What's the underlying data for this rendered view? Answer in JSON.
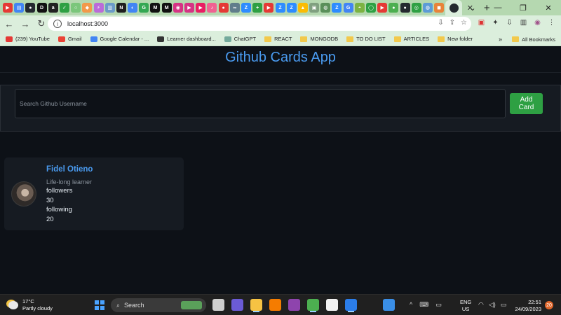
{
  "browser": {
    "tabs": [
      {
        "icon": "youtube-icon",
        "color": "#e53935",
        "glyph": "▶"
      },
      {
        "icon": "docs-icon",
        "color": "#4285f4",
        "glyph": "▤"
      },
      {
        "icon": "github-icon",
        "color": "#24292f",
        "glyph": "●"
      },
      {
        "icon": "dev-icon",
        "color": "#111111",
        "glyph": "D"
      },
      {
        "icon": "amazon-icon",
        "color": "#222222",
        "glyph": "a"
      },
      {
        "icon": "codepen-icon",
        "color": "#2ea043",
        "glyph": "✓"
      },
      {
        "icon": "gh-pages-icon",
        "color": "#7bc67b",
        "glyph": "○"
      },
      {
        "icon": "craft-icon",
        "color": "#f2994a",
        "glyph": "◆"
      },
      {
        "icon": "vitejs-icon",
        "color": "#bb6bd9",
        "glyph": "⚡"
      },
      {
        "icon": "database-icon",
        "color": "#6b9bc8",
        "glyph": "▥"
      },
      {
        "icon": "notion-icon",
        "color": "#1f1f1f",
        "glyph": "N"
      },
      {
        "icon": "chrome-app-icon",
        "color": "#4285f4",
        "glyph": "◐"
      },
      {
        "icon": "google-icon",
        "color": "#34a853",
        "glyph": "G"
      },
      {
        "icon": "medium-icon",
        "color": "#111111",
        "glyph": "M"
      },
      {
        "icon": "medium-alt-icon",
        "color": "#111111",
        "glyph": "M"
      },
      {
        "icon": "podcast-icon",
        "color": "#d63384",
        "glyph": "◉"
      },
      {
        "icon": "video-icon",
        "color": "#d63384",
        "glyph": "▶"
      },
      {
        "icon": "play-icon",
        "color": "#e91e63",
        "glyph": "▶"
      },
      {
        "icon": "music-icon",
        "color": "#f06292",
        "glyph": "♪"
      },
      {
        "icon": "record-icon",
        "color": "#e53935",
        "glyph": "●"
      },
      {
        "icon": "link-icon",
        "color": "#607d8b",
        "glyph": "∞"
      },
      {
        "icon": "zoom-icon",
        "color": "#2d8cff",
        "glyph": "Z"
      },
      {
        "icon": "plus-app-icon",
        "color": "#2ea043",
        "glyph": "+"
      },
      {
        "icon": "youtube-alt-icon",
        "color": "#e53935",
        "glyph": "▶"
      },
      {
        "icon": "zoom-alt-icon",
        "color": "#2d8cff",
        "glyph": "Z"
      },
      {
        "icon": "zoom-meet-icon",
        "color": "#2d8cff",
        "glyph": "Z"
      },
      {
        "icon": "drive-icon",
        "color": "#fbbc04",
        "glyph": "▲"
      },
      {
        "icon": "images-icon",
        "color": "#80a080",
        "glyph": "▣"
      },
      {
        "icon": "globe-icon",
        "color": "#5a8f5a",
        "glyph": "◍"
      },
      {
        "icon": "zoom-web-icon",
        "color": "#2d8cff",
        "glyph": "Z"
      },
      {
        "icon": "google-alt-icon",
        "color": "#4285f4",
        "glyph": "G"
      },
      {
        "icon": "gradient-icon",
        "color": "#7cb342",
        "glyph": "◓"
      },
      {
        "icon": "whatsapp-icon",
        "color": "#2ea043",
        "glyph": "◯"
      },
      {
        "icon": "youtube-third-icon",
        "color": "#e53935",
        "glyph": "▶"
      },
      {
        "icon": "circle-green-icon",
        "color": "#4caf50",
        "glyph": "●"
      },
      {
        "icon": "github-alt-icon",
        "color": "#24292f",
        "glyph": "●"
      },
      {
        "icon": "compass-icon",
        "color": "#2ea043",
        "glyph": "◎"
      },
      {
        "icon": "world-icon",
        "color": "#5c9bd6",
        "glyph": "◍"
      },
      {
        "icon": "bookmark-tab-icon",
        "color": "#e8833a",
        "glyph": "◼"
      }
    ],
    "close_glyph": "✕",
    "new_tab_glyph": "+",
    "window_controls": {
      "dropdown": "⌄",
      "minimize": "—",
      "restore": "❐",
      "close": "✕"
    },
    "nav": {
      "back": "←",
      "forward": "→",
      "reload": "↻"
    },
    "url": "localhost:3000",
    "info_glyph": "i",
    "omnibox_icons": {
      "install": "⇩",
      "share": "⇪",
      "star": "☆"
    },
    "extensions": {
      "ext1": "▣",
      "puzzle": "✦",
      "download": "⇩",
      "sidepanel": "▥",
      "profile": "◉",
      "menu": "⋮"
    },
    "bookmarks": [
      {
        "label": "(239) YouTube",
        "icon": "youtube-icon",
        "color": "#e53935",
        "folder": false
      },
      {
        "label": "Gmail",
        "icon": "gmail-icon",
        "color": "#ea4335",
        "folder": false
      },
      {
        "label": "Google Calendar - ...",
        "icon": "calendar-icon",
        "color": "#4285f4",
        "folder": false
      },
      {
        "label": "Learner dashboard...",
        "icon": "alx-icon",
        "color": "#333333",
        "folder": false
      },
      {
        "label": "ChatGPT",
        "icon": "chatgpt-icon",
        "color": "#74aa9c",
        "folder": false
      },
      {
        "label": "REACT",
        "icon": "folder-icon",
        "color": "#f2c94c",
        "folder": true
      },
      {
        "label": "MONGODB",
        "icon": "folder-icon",
        "color": "#f2c94c",
        "folder": true
      },
      {
        "label": "TO DO LIST",
        "icon": "folder-icon",
        "color": "#f2c94c",
        "folder": true
      },
      {
        "label": "ARTICLES",
        "icon": "folder-icon",
        "color": "#f2c94c",
        "folder": true
      },
      {
        "label": "New folder",
        "icon": "folder-icon",
        "color": "#f2c94c",
        "folder": true
      }
    ],
    "bookmarks_overflow": "»",
    "all_bookmarks": "All Bookmarks"
  },
  "app": {
    "title": "Github Cards App",
    "search_placeholder": "Search Github Username",
    "search_value": "",
    "add_button": "Add\nCard",
    "card": {
      "name": "Fidel Otieno",
      "bio": "Life-long learner",
      "followers_label": "followers",
      "followers": "30",
      "following_label": "following",
      "following": "20"
    }
  },
  "taskbar": {
    "weather_temp": "17°C",
    "weather_desc": "Partly cloudy",
    "search_label": "Search",
    "search_glyph": "⌕",
    "apps": [
      {
        "icon": "file-explorer-icon",
        "color": "#cfcfcf",
        "active": false
      },
      {
        "icon": "meet-now-icon",
        "color": "#6b5bd6",
        "active": false
      },
      {
        "icon": "folder-app-icon",
        "color": "#f6c343",
        "active": true
      },
      {
        "icon": "xampp-icon",
        "color": "#f57c00",
        "active": false
      },
      {
        "icon": "github-desktop-icon",
        "color": "#8e44ad",
        "active": false
      },
      {
        "icon": "chrome-icon",
        "color": "#4caf50",
        "active": true
      },
      {
        "icon": "notepad-icon",
        "color": "#f2f2f2",
        "active": false
      },
      {
        "icon": "vscode-icon",
        "color": "#2b7de9",
        "active": true
      },
      {
        "icon": "blank-app-icon",
        "color": "#202020",
        "active": false
      },
      {
        "icon": "snipping-icon",
        "color": "#3a8ee6",
        "active": false
      }
    ],
    "tray": {
      "chevron": "^",
      "keyboard": "⌨",
      "display": "▭"
    },
    "language": "ENG",
    "region": "US",
    "sys": {
      "wifi": "◠",
      "volume": "◁)",
      "battery": "▭"
    },
    "time": "22:51",
    "date": "24/09/2023",
    "notification_count": "20"
  }
}
